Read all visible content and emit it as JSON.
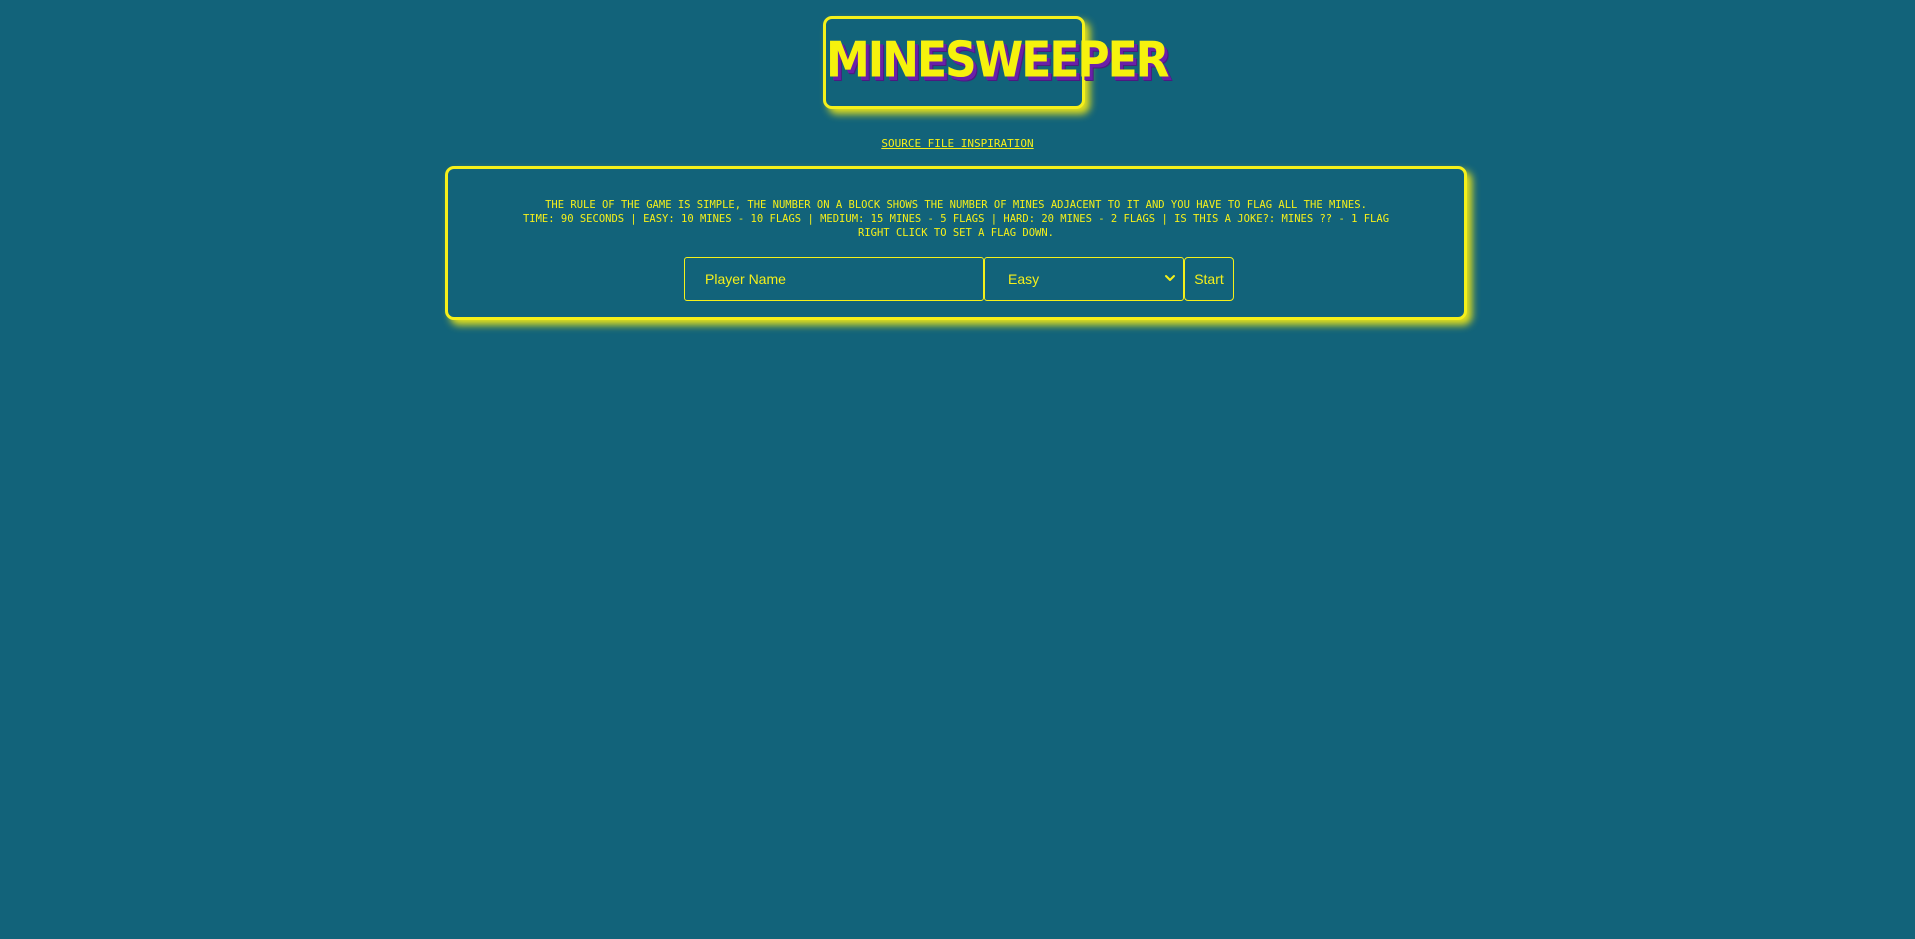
{
  "header": {
    "title": "MINESWEEPER"
  },
  "links": {
    "source": "SOURCE FILE INSPIRATION"
  },
  "rules": {
    "line1": "THE RULE OF THE GAME IS SIMPLE, THE NUMBER ON A BLOCK SHOWS THE NUMBER OF MINES ADJACENT TO IT AND YOU HAVE TO FLAG ALL THE MINES.",
    "line2": "TIME: 90 SECONDS | EASY: 10 MINES - 10 FLAGS | MEDIUM: 15 MINES - 5 FLAGS | HARD: 20 MINES - 2 FLAGS | IS THIS A JOKE?: MINES ?? - 1 FLAG",
    "line3": "RIGHT CLICK TO SET A FLAG DOWN."
  },
  "form": {
    "name_placeholder": "Player Name",
    "difficulty_value": "Easy",
    "start_label": "Start"
  },
  "icons": {
    "difficulty_chevron": "chevron-down-icon"
  },
  "colors": {
    "background": "#12637a",
    "accent": "#f5f01a",
    "title_shadow": "#6a1fa8"
  }
}
